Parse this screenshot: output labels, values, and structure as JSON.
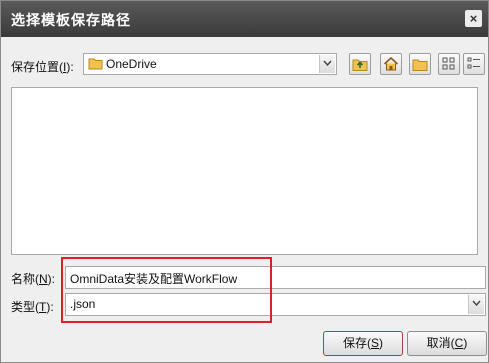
{
  "window": {
    "title": "选择模板保存路径",
    "close_glyph": "×"
  },
  "location": {
    "label_prefix": "保存位置(",
    "label_key": "I",
    "label_suffix": "):",
    "value": "OneDrive",
    "icon": "folder-icon"
  },
  "toolbar": {
    "buttons": [
      "up-folder-icon",
      "home-icon",
      "new-folder-icon",
      "list-view-icon",
      "details-view-icon"
    ]
  },
  "name_field": {
    "label_prefix": "名称(",
    "label_key": "N",
    "label_suffix": "):",
    "value": "OmniData安装及配置WorkFlow"
  },
  "type_field": {
    "label_prefix": "类型(",
    "label_key": "T",
    "label_suffix": "):",
    "value": ".json"
  },
  "buttons": {
    "save_prefix": "保存(",
    "save_key": "S",
    "save_suffix": ")",
    "cancel_prefix": "取消(",
    "cancel_key": "C",
    "cancel_suffix": ")"
  },
  "colors": {
    "titlebar": "#3f3f3f",
    "highlight": "#e02020",
    "folder": "#f2c14e"
  }
}
